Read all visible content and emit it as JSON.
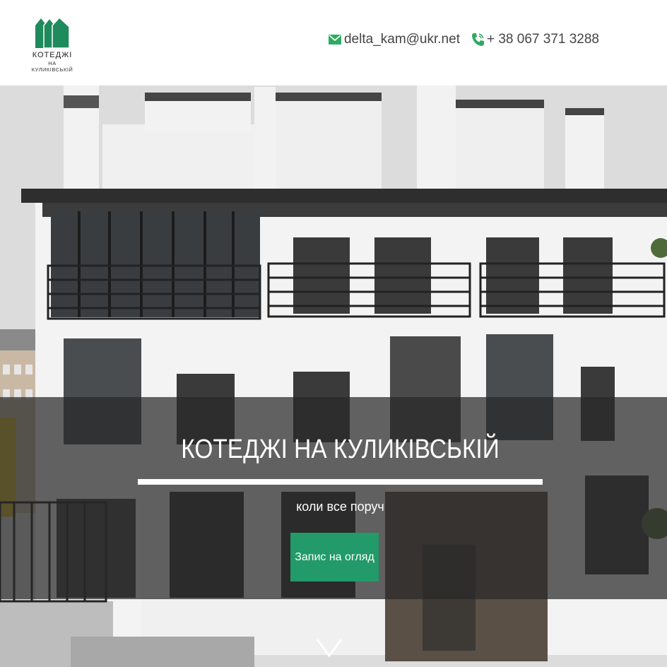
{
  "header": {
    "logo": {
      "title": "КОТЕДЖІ",
      "subtitle": "НА КУЛИКІВСЬКІЙ",
      "color": "#1f8a5c"
    },
    "contacts": {
      "email": {
        "icon": "envelope-icon",
        "text": "delta_kam@ukr.net"
      },
      "phone": {
        "icon": "phone-icon",
        "text": "+ 38 067 371 3288"
      },
      "icon_color": "#2eaa62"
    }
  },
  "hero": {
    "title": "КОТЕДЖІ НА КУЛИКІВСЬКІЙ",
    "subtitle": "коли все поруч",
    "cta_label": "Запис на огляд",
    "cta_color": "#229a6a",
    "scroll_icon": "chevron-down-icon"
  }
}
